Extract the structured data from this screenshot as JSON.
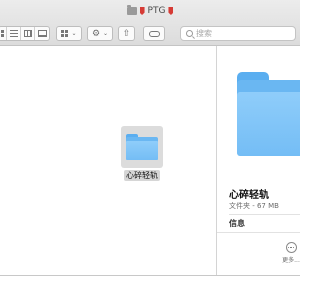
{
  "window": {
    "title": "PTG"
  },
  "toolbar": {
    "search_placeholder": "搜索"
  },
  "content": {
    "items": [
      {
        "name": "心碎轻轨",
        "type": "folder",
        "selected": true
      }
    ]
  },
  "preview": {
    "name": "心碎轻轨",
    "meta": "文件夹 - 67 MB",
    "section_title": "信息",
    "more_label": "更多..."
  },
  "colors": {
    "folder_blue": "#74bdf5",
    "tag_red": "#d63b35",
    "selection_gray": "#dcdcdc"
  },
  "icons": [
    "folder-icon",
    "red-tag-icon",
    "grid-view-icon",
    "list-view-icon",
    "column-view-icon",
    "gallery-view-icon",
    "group-icon",
    "action-gear-icon",
    "share-icon",
    "tag-icon",
    "search-icon",
    "more-icon"
  ]
}
